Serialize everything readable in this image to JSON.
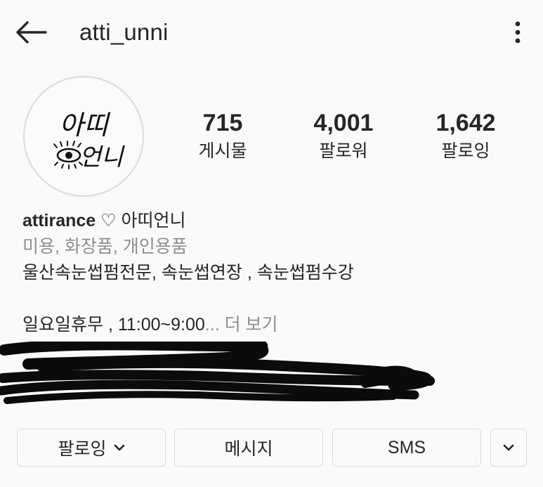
{
  "header": {
    "back_icon": "back-arrow-icon",
    "username": "atti_unni",
    "more_icon": "more-vertical-icon"
  },
  "profile": {
    "avatar_text": {
      "line1": "아띠",
      "line2": "언니"
    },
    "stats": [
      {
        "value": "715",
        "label": "게시물"
      },
      {
        "value": "4,001",
        "label": "팔로워"
      },
      {
        "value": "1,642",
        "label": "팔로잉"
      }
    ]
  },
  "bio": {
    "name_main": "attirance",
    "name_heart": "♡",
    "name_korean": "아띠언니",
    "category": "미용, 화장품, 개인용품",
    "line1": "울산속눈썹펌전문, 속눈썹연장 , 속눈썹펌수강",
    "line2_text": "일요일휴무 , 11:00~9:00",
    "line2_ellipsis": "...",
    "more_label": "더 보기"
  },
  "actions": {
    "following_label": "팔로잉",
    "message_label": "메시지",
    "sms_label": "SMS",
    "dropdown_icon": "chevron-down-icon"
  },
  "colors": {
    "background": "#fafafa",
    "text": "#262626",
    "secondary_text": "#8e8e8e",
    "border": "#dbdbdb"
  }
}
